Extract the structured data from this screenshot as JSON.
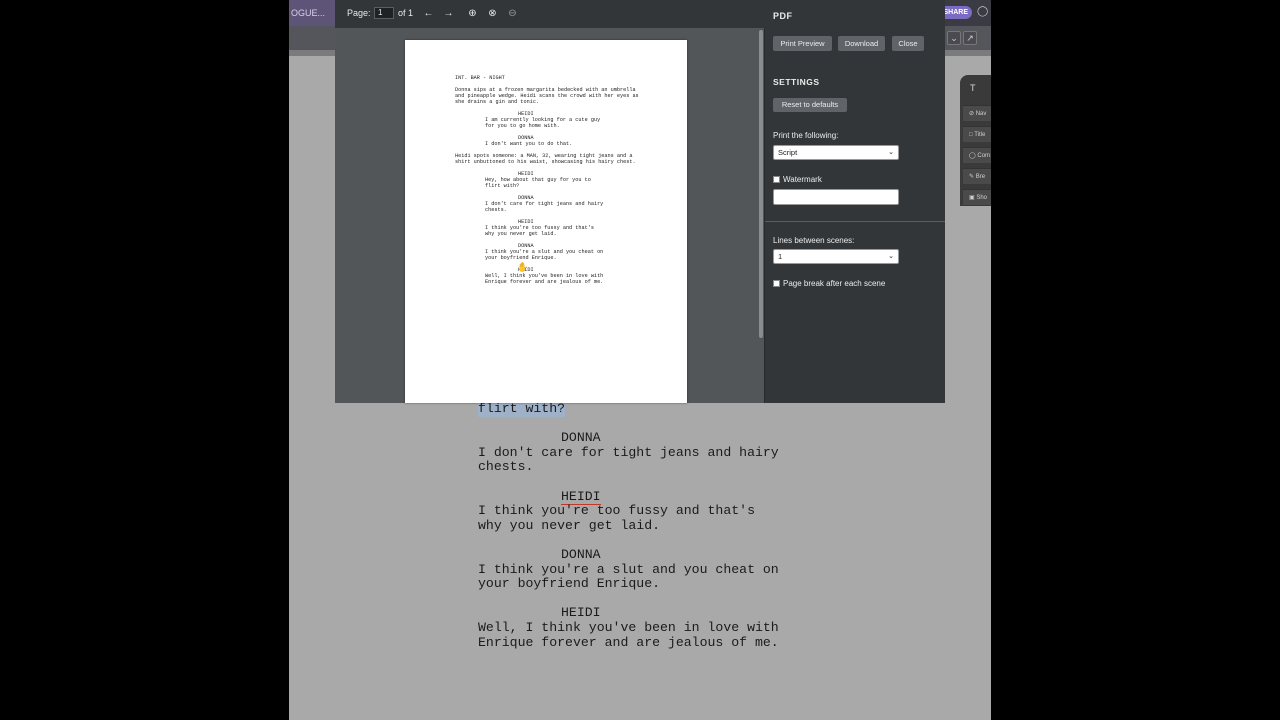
{
  "app": {
    "tab_label": "OGUE...",
    "share_label": "SHARE",
    "rail": {
      "head": "T",
      "items": [
        "Nav",
        "Title",
        "Com",
        "Bre",
        "Sho"
      ]
    },
    "screenplay": [
      {
        "text": "flirt with?",
        "style": "hl"
      },
      {
        "text": "DONNA",
        "style": "char"
      },
      {
        "text": "I don't care for tight jeans and hairy",
        "style": "dialog"
      },
      {
        "text": "chests.",
        "style": "dialog"
      },
      {
        "text": "HEIDI",
        "style": "char-ul"
      },
      {
        "text": "I think you're too fussy and that's",
        "style": "dialog"
      },
      {
        "text": "why you never get laid.",
        "style": "dialog"
      },
      {
        "text": "DONNA",
        "style": "char"
      },
      {
        "text": "I think you're a slut and you cheat on",
        "style": "dialog"
      },
      {
        "text": "your boyfriend Enrique.",
        "style": "dialog"
      },
      {
        "text": "HEIDI",
        "style": "char"
      },
      {
        "text": "Well, I think you've been in love with",
        "style": "dialog"
      },
      {
        "text": "Enrique forever and are jealous of me.",
        "style": "dialog"
      }
    ]
  },
  "pdf": {
    "page_label": "Page:",
    "page_value": "1",
    "page_of": "of 1",
    "icons": [
      "arrow-left-icon",
      "arrow-right-icon",
      "zoom-in-icon",
      "zoom-fit-icon",
      "zoom-out-icon"
    ],
    "page_lines": [
      {
        "t": "INT. BAR - NIGHT",
        "k": "action"
      },
      {
        "t": "",
        "k": "action"
      },
      {
        "t": "Donna sips at a frozen margarita bedecked with an umbrella",
        "k": "action"
      },
      {
        "t": "and pineapple wedge. Heidi scans the crowd with her eyes as",
        "k": "action"
      },
      {
        "t": "she drains a gin and tonic.",
        "k": "action"
      },
      {
        "t": "",
        "k": "action"
      },
      {
        "t": "HEIDI",
        "k": "char"
      },
      {
        "t": "I am currently looking for a cute guy",
        "k": "dialog"
      },
      {
        "t": "for you to go home with.",
        "k": "dialog"
      },
      {
        "t": "",
        "k": "action"
      },
      {
        "t": "DONNA",
        "k": "char"
      },
      {
        "t": "I don't want you to do that.",
        "k": "dialog"
      },
      {
        "t": "",
        "k": "action"
      },
      {
        "t": "Heidi spots someone: a MAN, 32, wearing tight jeans and a",
        "k": "action"
      },
      {
        "t": "shirt unbuttoned to his waist, showcasing his hairy chest.",
        "k": "action"
      },
      {
        "t": "",
        "k": "action"
      },
      {
        "t": "HEIDI",
        "k": "char"
      },
      {
        "t": "Hey, how about that guy for you to",
        "k": "dialog"
      },
      {
        "t": "flirt with?",
        "k": "dialog"
      },
      {
        "t": "",
        "k": "action"
      },
      {
        "t": "DONNA",
        "k": "char"
      },
      {
        "t": "I don't care for tight jeans and hairy",
        "k": "dialog"
      },
      {
        "t": "chests.",
        "k": "dialog"
      },
      {
        "t": "",
        "k": "action"
      },
      {
        "t": "HEIDI",
        "k": "char"
      },
      {
        "t": "I think you're too fussy and that's",
        "k": "dialog"
      },
      {
        "t": "why you never get laid.",
        "k": "dialog"
      },
      {
        "t": "",
        "k": "action"
      },
      {
        "t": "DONNA",
        "k": "char"
      },
      {
        "t": "I think you're a slut and you cheat on",
        "k": "dialog"
      },
      {
        "t": "your boyfriend Enrique.",
        "k": "dialog"
      },
      {
        "t": "",
        "k": "action"
      },
      {
        "t": "HEIDI",
        "k": "char"
      },
      {
        "t": "Well, I think you've been in love with",
        "k": "dialog"
      },
      {
        "t": "Enrique forever and are jealous of me.",
        "k": "dialog"
      }
    ]
  },
  "settings": {
    "title": "PDF",
    "print_preview": "Print Preview",
    "download": "Download",
    "close": "Close",
    "section": "SETTINGS",
    "reset": "Reset to defaults",
    "print_following_label": "Print the following:",
    "print_following_value": "Script",
    "watermark_label": "Watermark",
    "watermark_value": "",
    "lines_between_label": "Lines between scenes:",
    "lines_between_value": "1",
    "page_break_label": "Page break after each scene"
  }
}
